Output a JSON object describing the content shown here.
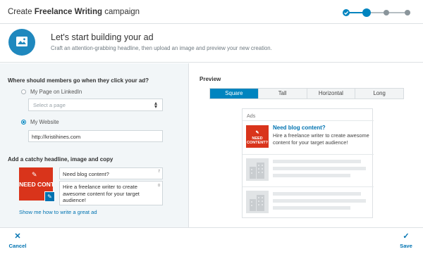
{
  "header": {
    "title_prefix": "Create ",
    "title_bold": "Freelance Writing",
    "title_suffix": " campaign",
    "progress": {
      "current_step": 2,
      "total_steps": 4
    },
    "accent_color": "#0084bf"
  },
  "intro": {
    "icon": "image-icon",
    "title": "Let's start building your ad",
    "subtitle": "Craft an attention-grabbing headline, then upload an image and preview your new creation."
  },
  "destination": {
    "question": "Where should members go when they click your ad?",
    "option_linkedin": "My Page on LinkedIn",
    "page_select_placeholder": "Select a page",
    "option_website": "My Website",
    "selected_option": "My Website",
    "website_url": "http://kristihines.com"
  },
  "creative": {
    "section_label": "Add a catchy headline, image and copy",
    "image_text": "NEED CONTENT?",
    "image_color": "#d9341b",
    "headline": "Need blog content?",
    "headline_counter": "7",
    "body": "Hire a freelance writer to create awesome content for your target audience!",
    "body_counter": "0",
    "help_link": "Show me how to write a great ad"
  },
  "preview": {
    "label": "Preview",
    "tabs": [
      "Square",
      "Tall",
      "Horizontal",
      "Long"
    ],
    "active_tab": "Square",
    "card_header": "Ads",
    "ad_title": "Need blog content?",
    "ad_body": "Hire a freelance writer to create awesome content for your target audience!",
    "thumb_line1": "NEED",
    "thumb_line2": "CONTENT?"
  },
  "footer": {
    "cancel_label": "Cancel",
    "save_label": "Save"
  }
}
